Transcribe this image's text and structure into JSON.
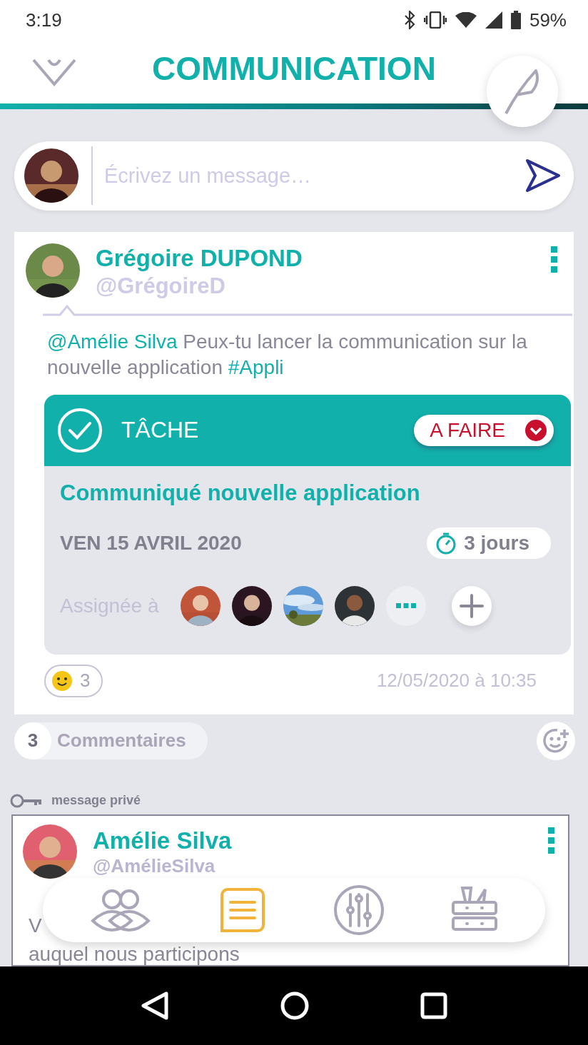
{
  "status_bar": {
    "time": "3:19",
    "battery": "59%"
  },
  "header": {
    "title": "COMMUNICATION"
  },
  "composer": {
    "placeholder": "Écrivez un message…"
  },
  "post": {
    "author": "Grégoire DUPOND",
    "handle": "@GrégoireD",
    "text_parts": [
      {
        "kind": "mention",
        "text": "@Amélie Silva"
      },
      {
        "kind": "plain",
        "text": " Peux-tu lancer la communication sur la nouvelle application "
      },
      {
        "kind": "tag",
        "text": "#Appli"
      }
    ],
    "task": {
      "label": "TÂCHE",
      "status": "A FAIRE",
      "title": "Communiqué nouvelle application",
      "date": "VEN 15 AVRIL 2020",
      "duration": "3 jours",
      "assigned_label": "Assignée à"
    },
    "reactions": "3",
    "timestamp": "12/05/2020 à 10:35"
  },
  "comments": {
    "count": "3",
    "label": "Commentaires"
  },
  "private_post": {
    "label": "message privé",
    "author": "Amélie Silva",
    "handle": "@AmélieSilva",
    "body_lines": [
      "V",
      "auquel nous participons"
    ]
  },
  "bottom_nav": [
    {
      "kind": "people",
      "selected": false
    },
    {
      "kind": "list",
      "selected": true
    },
    {
      "kind": "sliders",
      "selected": false
    },
    {
      "kind": "drawers",
      "selected": false
    }
  ]
}
